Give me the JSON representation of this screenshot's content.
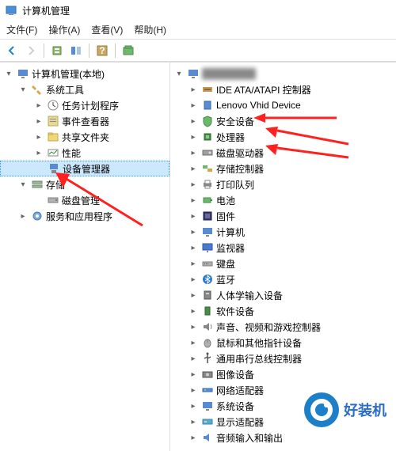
{
  "title": "计算机管理",
  "menu": {
    "file": "文件(F)",
    "action": "操作(A)",
    "view": "查看(V)",
    "help": "帮助(H)"
  },
  "left_tree": {
    "root": "计算机管理(本地)",
    "system_tools": "系统工具",
    "task_scheduler": "任务计划程序",
    "event_viewer": "事件查看器",
    "shared_folders": "共享文件夹",
    "performance": "性能",
    "device_manager": "设备管理器",
    "storage": "存储",
    "disk_management": "磁盘管理",
    "services_apps": "服务和应用程序"
  },
  "right_tree": {
    "ide": "IDE ATA/ATAPI 控制器",
    "lenovo": "Lenovo Vhid Device",
    "security": "安全设备",
    "processor": "处理器",
    "disk_drives": "磁盘驱动器",
    "storage_controllers": "存储控制器",
    "print_queues": "打印队列",
    "battery": "电池",
    "firmware": "固件",
    "computer": "计算机",
    "monitors": "监视器",
    "keyboards": "键盘",
    "bluetooth": "蓝牙",
    "hid": "人体学输入设备",
    "software_devices": "软件设备",
    "sound": "声音、视频和游戏控制器",
    "mouse": "鼠标和其他指针设备",
    "usb": "通用串行总线控制器",
    "imaging": "图像设备",
    "network": "网络适配器",
    "system_devices": "系统设备",
    "display": "显示适配器",
    "audio_io": "音频输入和输出"
  },
  "watermark": {
    "text": "好装机"
  }
}
